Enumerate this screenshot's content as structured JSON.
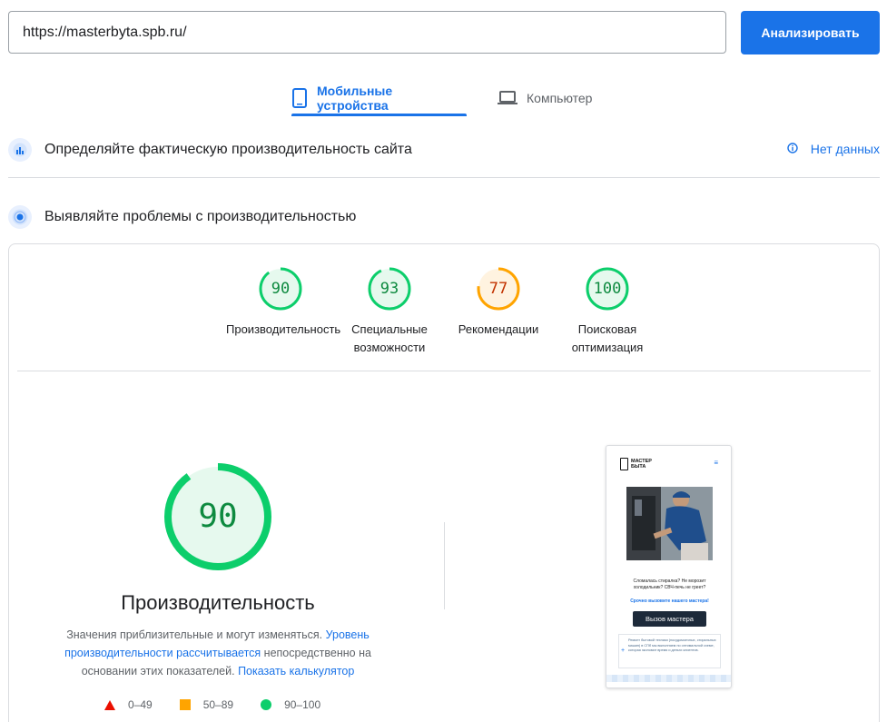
{
  "search": {
    "url_value": "https://masterbyta.spb.ru/",
    "analyze_label": "Анализировать"
  },
  "tabs": [
    {
      "label": "Мобильные устройства",
      "icon": "smartphone-icon",
      "active": true
    },
    {
      "label": "Компьютер",
      "icon": "laptop-icon",
      "active": false
    }
  ],
  "field_data": {
    "title": "Определяйте фактическую производительность сайта",
    "status": "Нет данных"
  },
  "lab_data": {
    "title": "Выявляйте проблемы с производительностью"
  },
  "scores": [
    {
      "value": "90",
      "label": "Производительность",
      "rating": "pass"
    },
    {
      "value": "93",
      "label": "Специальные возможности",
      "rating": "pass"
    },
    {
      "value": "77",
      "label": "Рекомендации",
      "rating": "average"
    },
    {
      "value": "100",
      "label": "Поисковая оптимизация",
      "rating": "pass"
    }
  ],
  "performance": {
    "score": "90",
    "title": "Производительность",
    "desc_1": "Значения приблизительные и могут изменяться. ",
    "desc_link_1": "Уровень производительности рассчитывается",
    "desc_2": " непосредственно на основании этих показателей. ",
    "desc_link_2": "Показать калькулятор"
  },
  "legend": [
    {
      "range": "0–49",
      "shape": "triangle",
      "color": "#eb0f00"
    },
    {
      "range": "50–89",
      "shape": "square",
      "color": "#ffa400"
    },
    {
      "range": "90–100",
      "shape": "circle",
      "color": "#0cce6b"
    }
  ],
  "screenshot": {
    "logo_line_1": "МАСТЕР",
    "logo_line_2": "БЫТА",
    "text": "Сломалась стиралка? Не морозит холодильник? СВЧ-печь не греет?",
    "link": "Срочно вызовите нашего мастера!",
    "button": "Вызов мастера",
    "box_text": "Ремонт бытовой техники (посудомоечных, стиральных машин) в СПб мы выполняем по оптимальной схеме, которая экономит время и деньги клиентов."
  },
  "colors": {
    "accent": "#1a73e8",
    "pass": "#0cce6b",
    "average": "#ffa400",
    "fail": "#eb0f00"
  }
}
